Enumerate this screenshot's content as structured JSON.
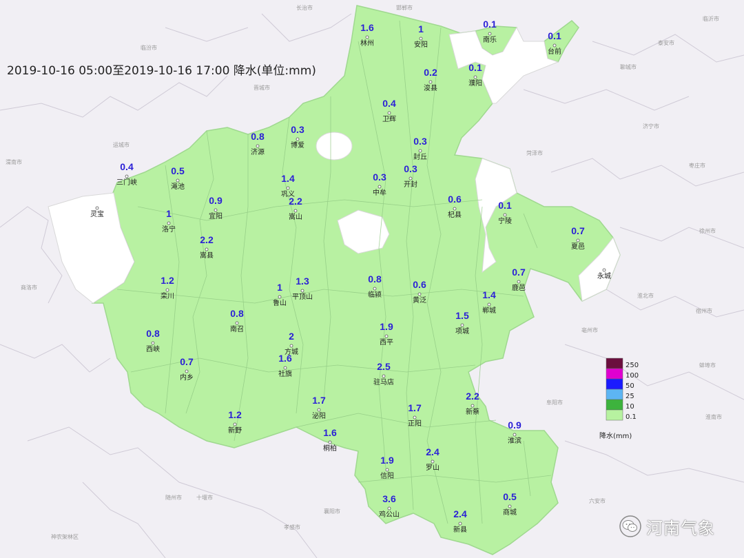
{
  "title": "2019-10-16 05:00至2019-10-16 17:00 降水(单位:mm)",
  "legend": {
    "title": "降水(mm)",
    "levels": [
      {
        "label": "250",
        "color": "#6b0f3e"
      },
      {
        "label": "100",
        "color": "#e000d0"
      },
      {
        "label": "50",
        "color": "#1b1bff"
      },
      {
        "label": "25",
        "color": "#5db5f3"
      },
      {
        "label": "10",
        "color": "#3db33d"
      },
      {
        "label": "0.1",
        "color": "#b7f2a0"
      }
    ]
  },
  "colors": {
    "rain_fill": "#b8f1a2",
    "no_rain": "#ffffff",
    "background": "#f1eff4",
    "value_text": "#2a1fd6"
  },
  "stations": [
    {
      "name": "林州",
      "value": "1.6"
    },
    {
      "name": "安阳",
      "value": "1"
    },
    {
      "name": "南乐",
      "value": "0.1"
    },
    {
      "name": "台前",
      "value": "0.1"
    },
    {
      "name": "濮阳",
      "value": "0.1"
    },
    {
      "name": "浚县",
      "value": "0.2"
    },
    {
      "name": "卫辉",
      "value": "0.4"
    },
    {
      "name": "济源",
      "value": "0.8"
    },
    {
      "name": "博爱",
      "value": "0.3"
    },
    {
      "name": "封丘",
      "value": "0.3"
    },
    {
      "name": "开封",
      "value": "0.3"
    },
    {
      "name": "中牟",
      "value": "0.3"
    },
    {
      "name": "三门峡",
      "value": "0.4"
    },
    {
      "name": "渑池",
      "value": "0.5"
    },
    {
      "name": "巩义",
      "value": "1.4"
    },
    {
      "name": "宜阳",
      "value": "0.9"
    },
    {
      "name": "嵩山",
      "value": "2.2"
    },
    {
      "name": "杞县",
      "value": "0.6"
    },
    {
      "name": "宁陵",
      "value": "0.1"
    },
    {
      "name": "夏邑",
      "value": "0.7"
    },
    {
      "name": "灵宝",
      "value": ""
    },
    {
      "name": "永城",
      "value": ""
    },
    {
      "name": "洛宁",
      "value": "1"
    },
    {
      "name": "嵩县",
      "value": "2.2"
    },
    {
      "name": "栾川",
      "value": "1.2"
    },
    {
      "name": "鲁山",
      "value": "1"
    },
    {
      "name": "平顶山",
      "value": "1.3"
    },
    {
      "name": "临颍",
      "value": "0.8"
    },
    {
      "name": "黄泛",
      "value": "0.6"
    },
    {
      "name": "鹿邑",
      "value": "0.7"
    },
    {
      "name": "郸城",
      "value": "1.4"
    },
    {
      "name": "项城",
      "value": "1.5"
    },
    {
      "name": "南召",
      "value": "0.8"
    },
    {
      "name": "西峡",
      "value": "0.8"
    },
    {
      "name": "方城",
      "value": "2"
    },
    {
      "name": "社旗",
      "value": "1.6"
    },
    {
      "name": "内乡",
      "value": "0.7"
    },
    {
      "name": "西平",
      "value": "1.9"
    },
    {
      "name": "驻马店",
      "value": "2.5"
    },
    {
      "name": "泌阳",
      "value": "1.7"
    },
    {
      "name": "新野",
      "value": "1.2"
    },
    {
      "name": "正阳",
      "value": "1.7"
    },
    {
      "name": "新蔡",
      "value": "2.2"
    },
    {
      "name": "桐柏",
      "value": "1.6"
    },
    {
      "name": "淮滨",
      "value": "0.9"
    },
    {
      "name": "罗山",
      "value": "2.4"
    },
    {
      "name": "信阳",
      "value": "1.9"
    },
    {
      "name": "鸡公山",
      "value": "3.6"
    },
    {
      "name": "商城",
      "value": "0.5"
    },
    {
      "name": "新县",
      "value": "2.4"
    }
  ],
  "background_labels": [
    "长治市",
    "邯郸市",
    "临汾市",
    "晋城市",
    "运城市",
    "渭南市",
    "菏泽市",
    "济宁市",
    "枣庄市",
    "商洛市",
    "徐州市",
    "亳州市",
    "宿州市",
    "淮北市",
    "蚌埠市",
    "阜阳市",
    "淮南市",
    "六安市",
    "十堰市",
    "襄阳市",
    "随州市",
    "孝感市",
    "神农架林区",
    "泰安市",
    "临沂市",
    "聊城市"
  ],
  "watermark": "河南气象"
}
